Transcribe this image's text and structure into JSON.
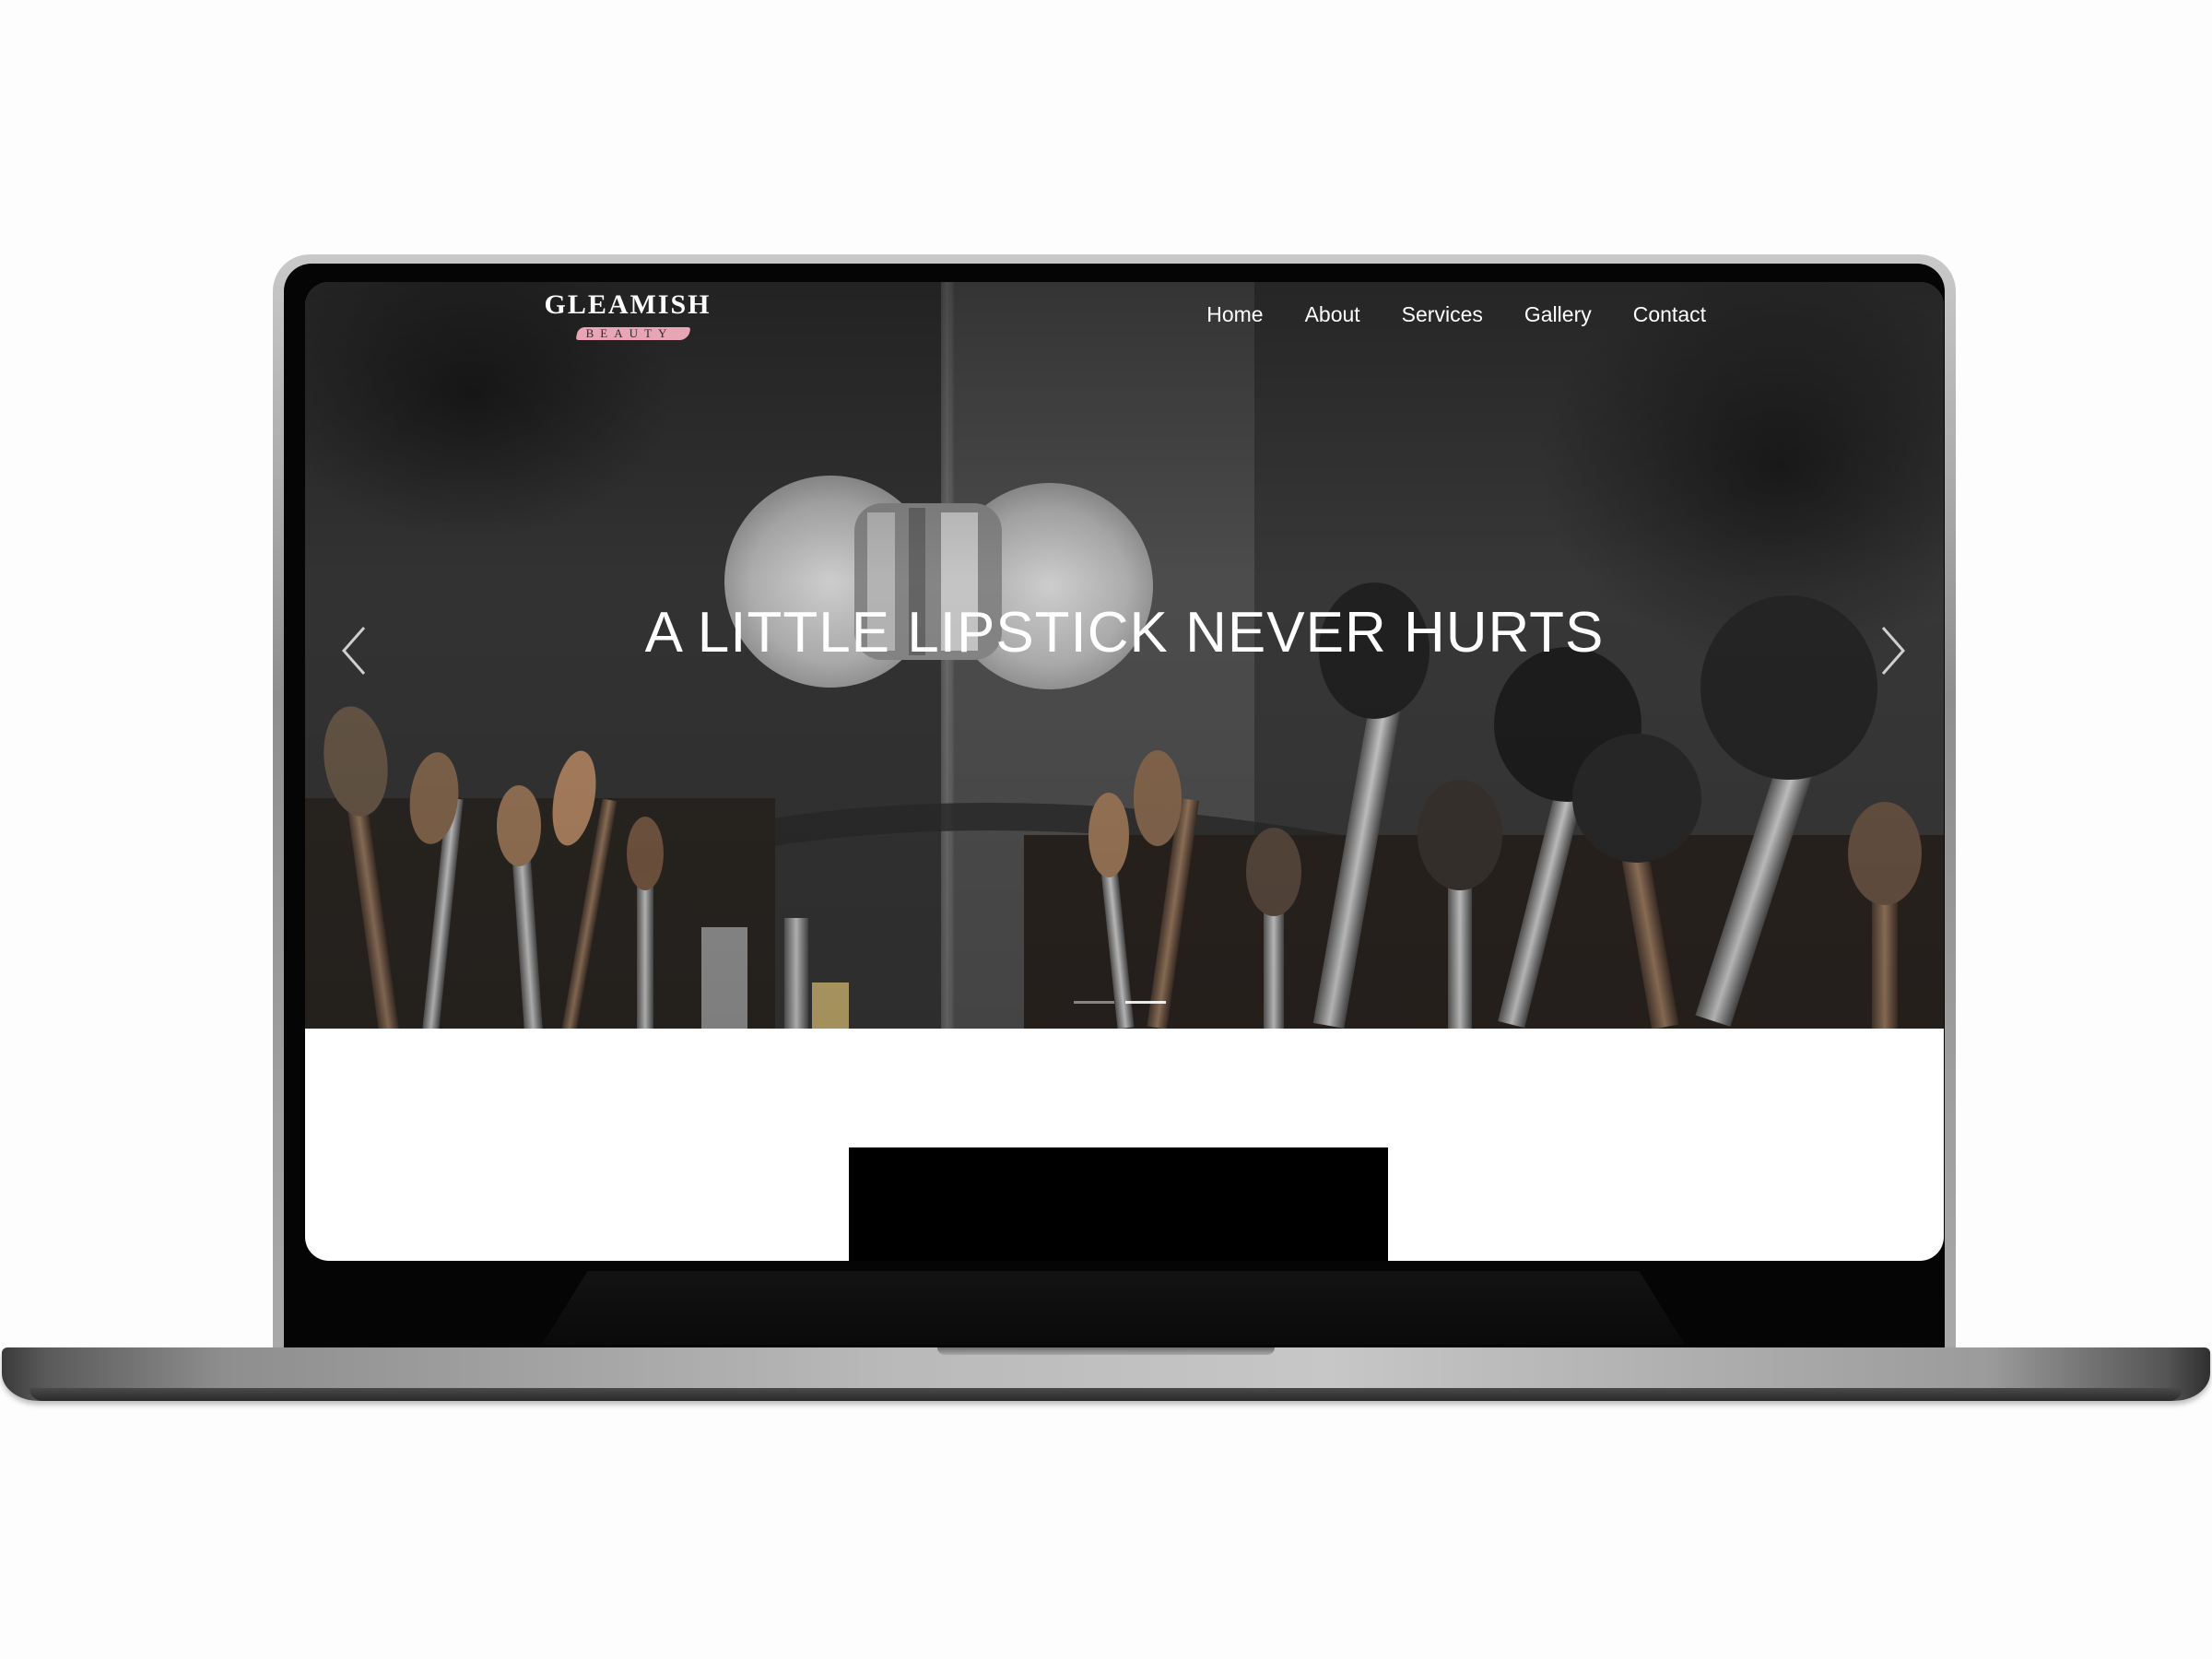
{
  "brand": {
    "name": "GLEAMISH",
    "tagline": "BEAUTY"
  },
  "nav": {
    "items": [
      {
        "label": "Home"
      },
      {
        "label": "About"
      },
      {
        "label": "Services"
      },
      {
        "label": "Gallery"
      },
      {
        "label": "Contact"
      }
    ]
  },
  "hero": {
    "headline": "A LITTLE LIPSTICK NEVER HURTS",
    "slide_count": 2,
    "active_slide": 2
  },
  "colors": {
    "accent_brush": "#e8a5b5",
    "hero_text": "#ffffff",
    "page_background": "#ffffff"
  },
  "icons": {
    "prev": "chevron-left-icon",
    "next": "chevron-right-icon"
  }
}
